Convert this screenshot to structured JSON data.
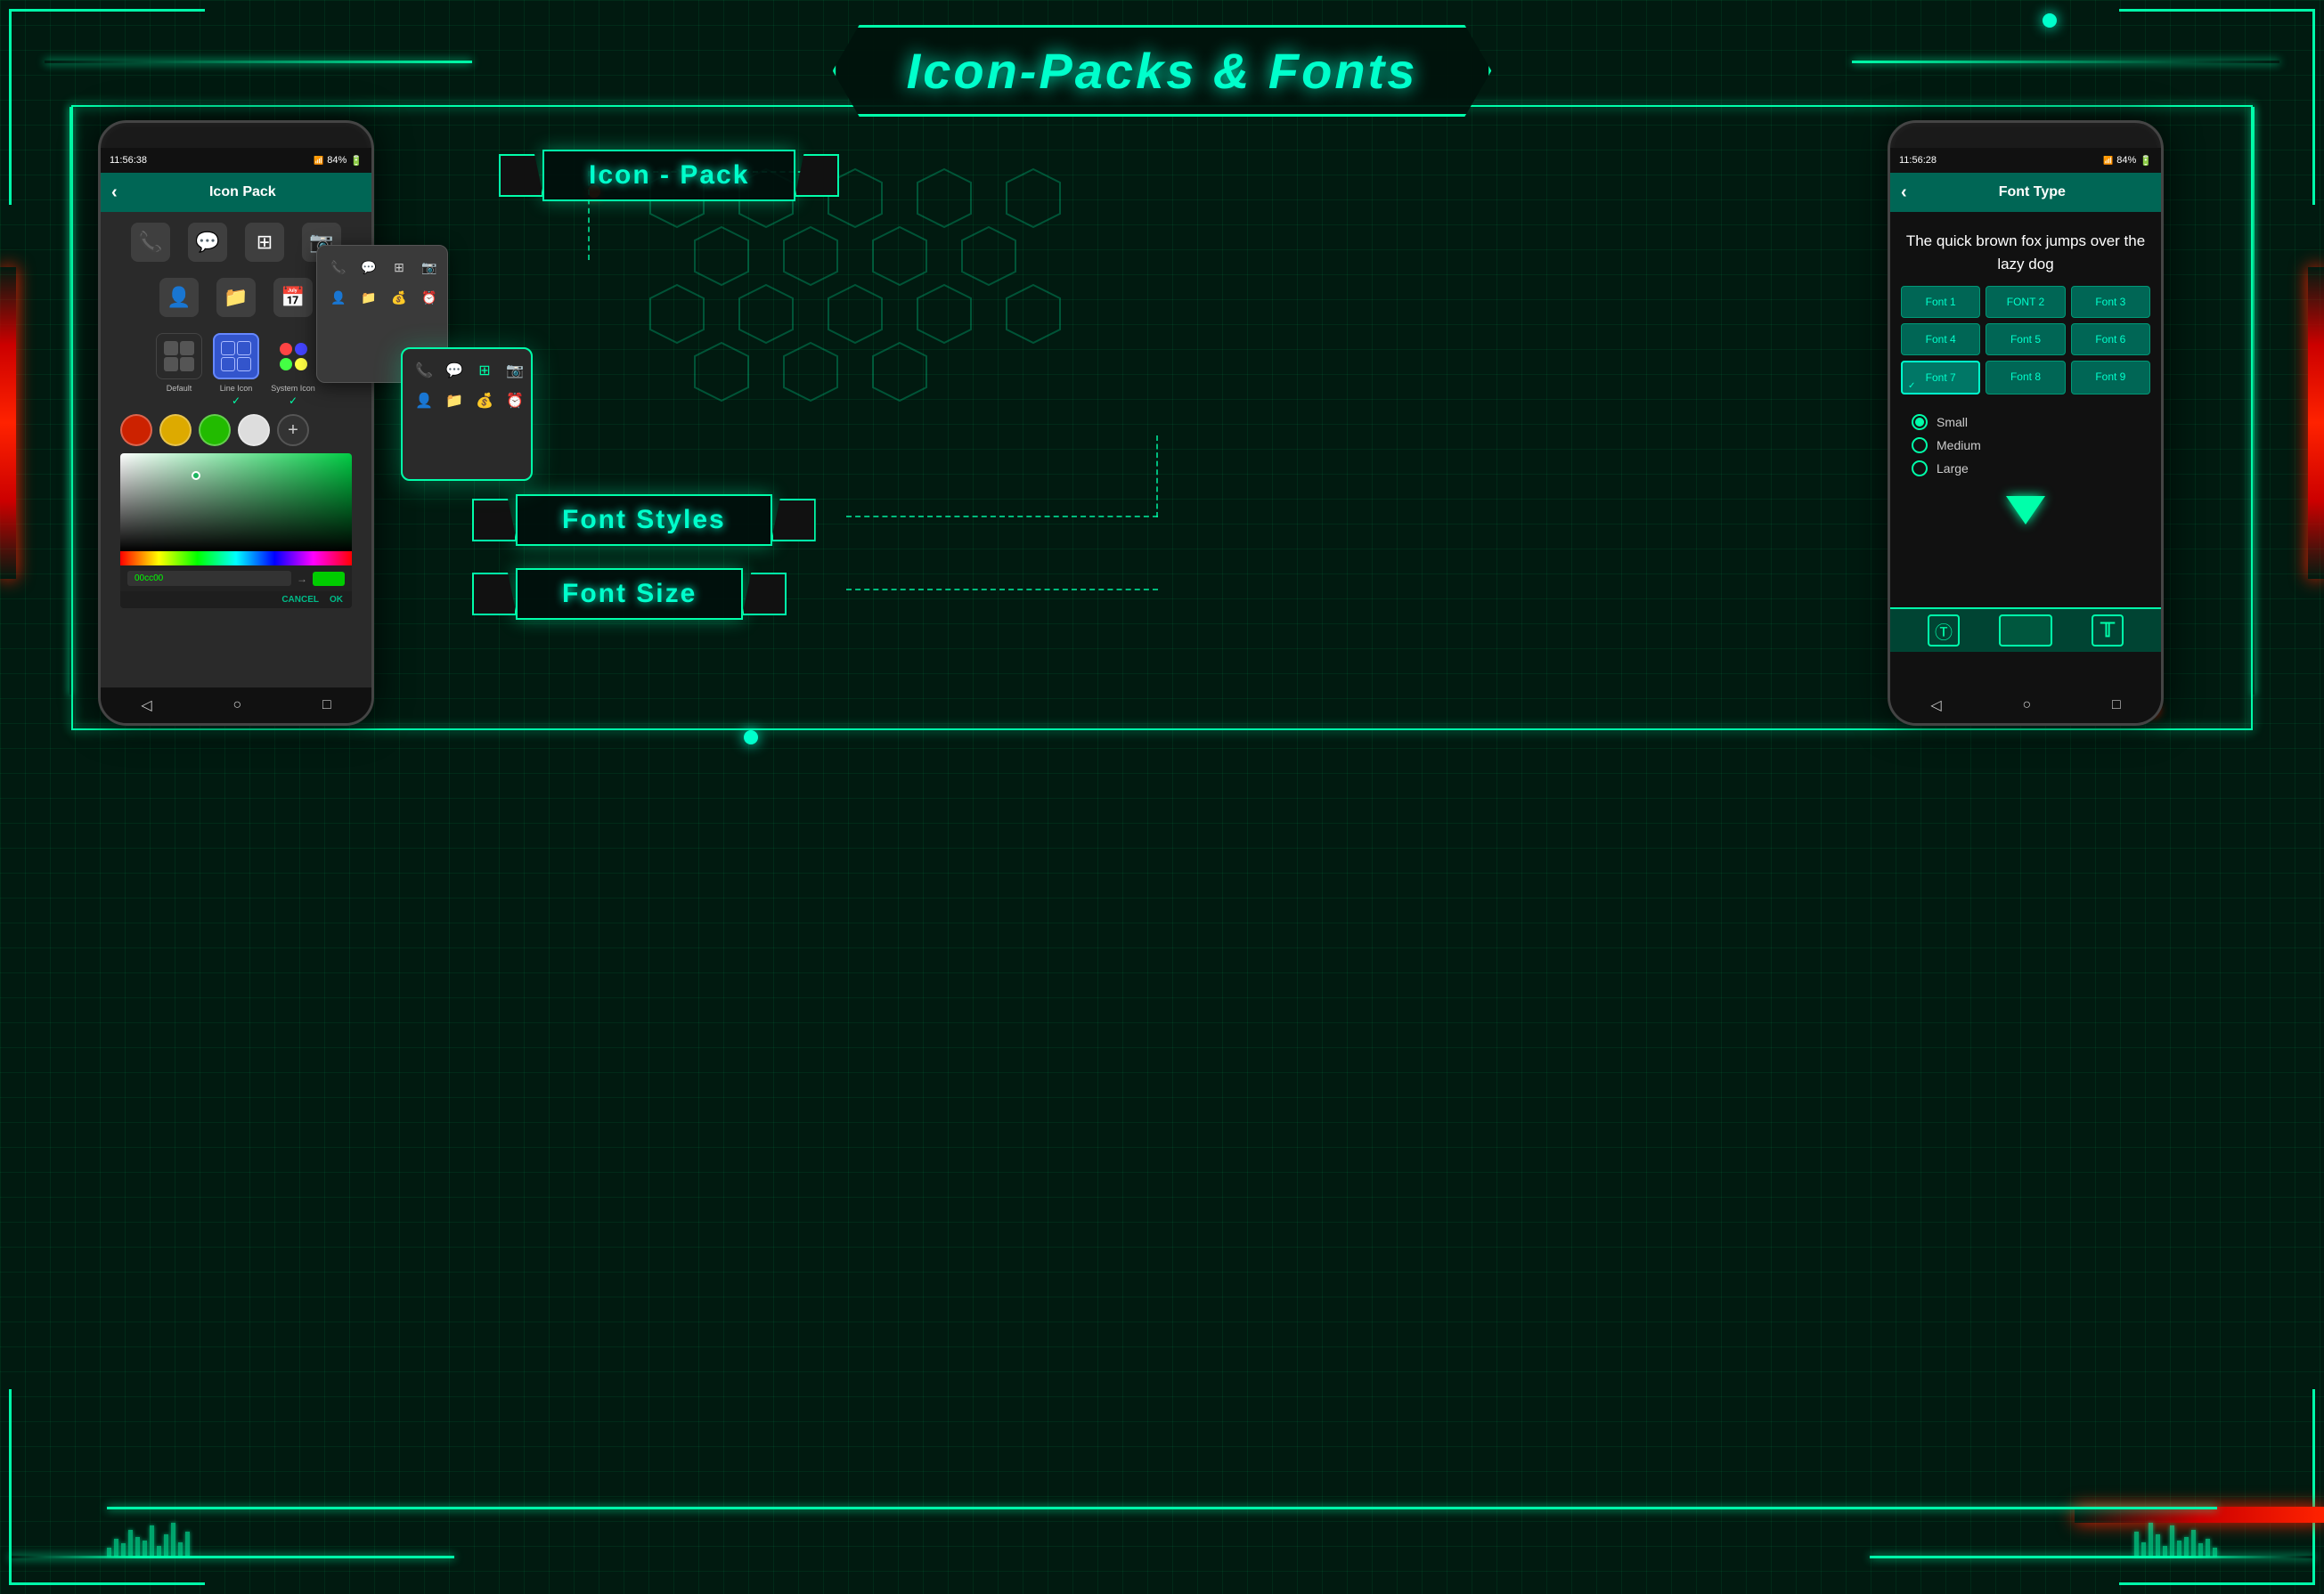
{
  "title": "Icon-Packs & Fonts",
  "page_title": "Icon-Packs & Fonts",
  "left_phone": {
    "status_bar": {
      "time": "11:56:38",
      "battery": "84%"
    },
    "toolbar": {
      "back_label": "‹",
      "title": "Icon Pack"
    },
    "icon_packs": [
      {
        "name": "Default",
        "checked": false
      },
      {
        "name": "Line Icon",
        "checked": true
      },
      {
        "name": "System Icon",
        "checked": true
      }
    ],
    "colors": [
      "#cc2200",
      "#ddaa00",
      "#22bb00",
      "#dddddd"
    ],
    "cancel_label": "CANCEL",
    "ok_label": "OK"
  },
  "right_phone": {
    "status_bar": {
      "time": "11:56:28",
      "battery": "84%"
    },
    "toolbar": {
      "back_label": "‹",
      "title": "Font Type"
    },
    "preview_text": "The quick brown fox jumps over the lazy dog",
    "fonts": [
      {
        "label": "Font 1",
        "active": false
      },
      {
        "label": "FONT 2",
        "active": false
      },
      {
        "label": "Font 3",
        "active": false
      },
      {
        "label": "Font 4",
        "active": false
      },
      {
        "label": "Font 5",
        "active": false
      },
      {
        "label": "Font 6",
        "active": false
      },
      {
        "label": "Font 7",
        "active": true
      },
      {
        "label": "Font 8",
        "active": false
      },
      {
        "label": "Font 9",
        "active": false
      }
    ],
    "sizes": [
      {
        "label": "Small",
        "selected": true
      },
      {
        "label": "Medium",
        "selected": false
      },
      {
        "label": "Large",
        "selected": false
      }
    ]
  },
  "banners": {
    "icon_pack": "Icon - Pack",
    "font_styles": "Font Styles",
    "font_size": "Font Size"
  }
}
